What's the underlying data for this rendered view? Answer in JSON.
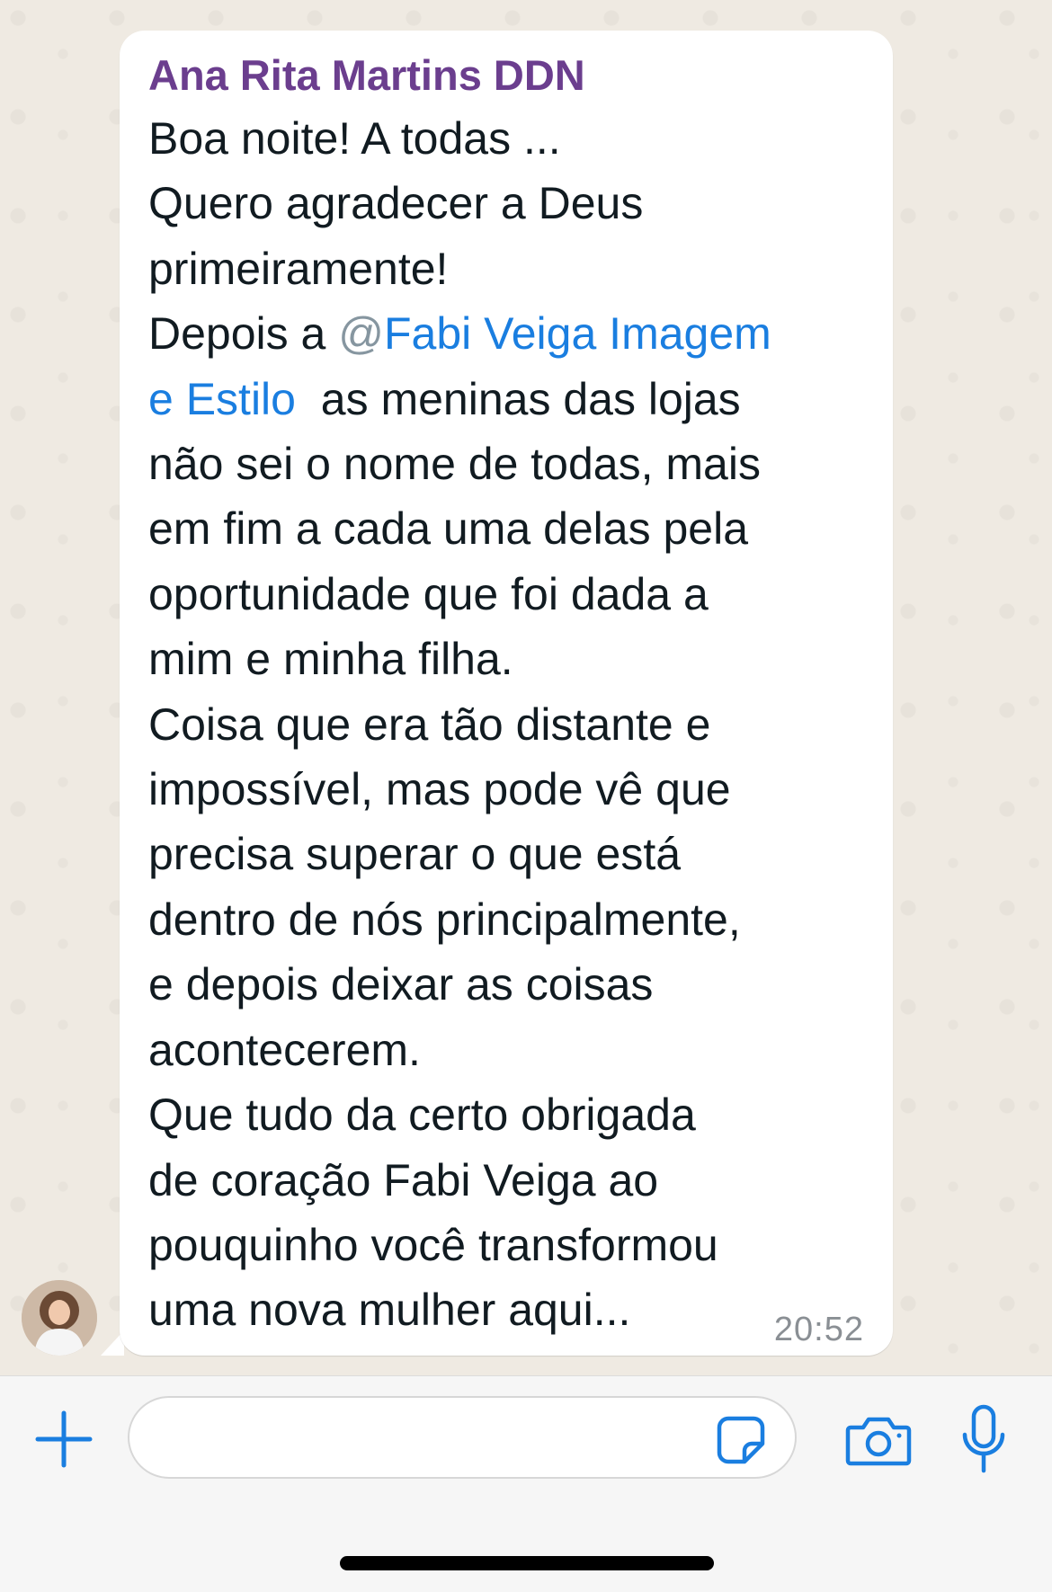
{
  "chat": {
    "message": {
      "sender": "Ana Rita Martins DDN",
      "lines": [
        "Boa noite! A todas ...",
        "Quero agradecer a Deus",
        "primeiramente!",
        "Depois a ",
        "as meninas das lojas",
        "não sei o nome de todas, mais",
        "em fim a cada uma delas pela",
        "oportunidade que foi dada a",
        "mim e minha filha.",
        "Coisa que era tão distante e",
        "impossível, mas pode vê que",
        "precisa superar o que está",
        "dentro de nós principalmente,",
        "e depois deixar as coisas",
        "acontecerem.",
        "Que tudo da certo obrigada",
        "de coração Fabi Veiga  ao",
        "pouquinho você transformou",
        "uma nova mulher aqui..."
      ],
      "mention": {
        "at": "@",
        "name_line1": "Fabi Veiga Imagem",
        "name_line2": "e Estilo"
      },
      "time": "20:52"
    }
  },
  "composer": {
    "input_value": "",
    "icons": [
      "plus-icon",
      "sticker-icon",
      "camera-icon",
      "microphone-icon"
    ],
    "accent_color": "#1a7ee0"
  }
}
